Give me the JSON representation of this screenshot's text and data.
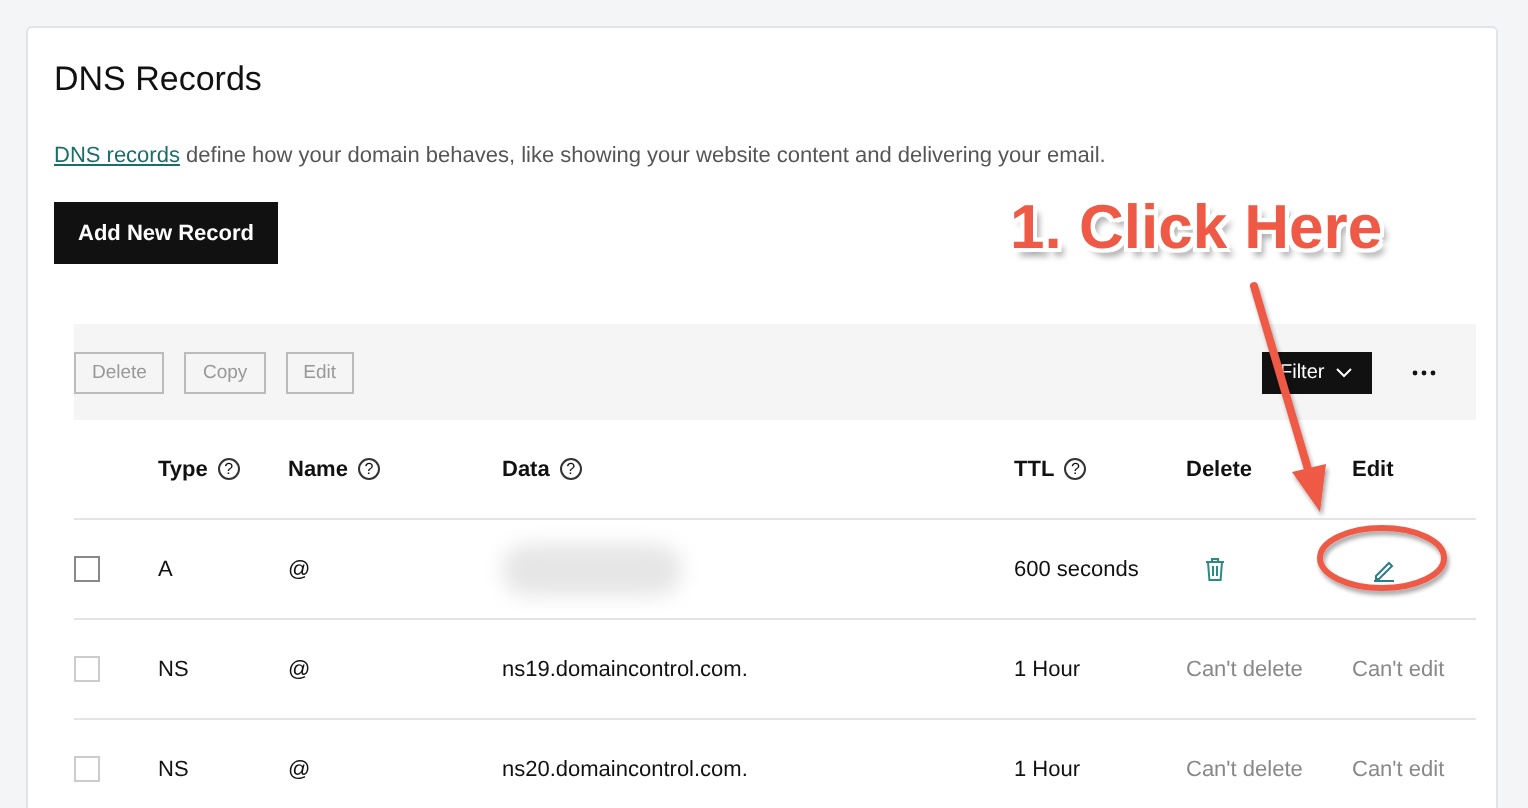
{
  "page": {
    "title": "DNS Records",
    "description": {
      "link": "DNS records",
      "text": "define how your domain behaves, like showing your website content and delivering your email."
    },
    "add_button": "Add New Record"
  },
  "toolbar": {
    "buttons": [
      "Delete",
      "Copy",
      "Edit"
    ],
    "filter": "Filter"
  },
  "table": {
    "columns": [
      {
        "label": "Type",
        "help": "?"
      },
      {
        "label": "Name",
        "help": "?"
      },
      {
        "label": "Data",
        "help": "?"
      },
      {
        "label": "TTL",
        "help": "?"
      },
      {
        "label": "Delete"
      },
      {
        "label": "Edit"
      }
    ],
    "rows": [
      {
        "kind": "editable",
        "disabled": false,
        "type": "A",
        "name": "@",
        "data_blurred": true,
        "ttl": "600 seconds"
      },
      {
        "kind": "locked",
        "disabled": true,
        "type": "NS",
        "name": "@",
        "data": "ns19.domaincontrol.com.",
        "ttl": "1 Hour",
        "delete_label": "Can't delete",
        "edit_label": "Can't edit"
      },
      {
        "kind": "locked",
        "disabled": true,
        "type": "NS",
        "name": "@",
        "data": "ns20.domaincontrol.com.",
        "ttl": "1 Hour",
        "delete_label": "Can't delete",
        "edit_label": "Can't edit"
      }
    ]
  },
  "annotation": {
    "text": "1. Click Here"
  }
}
